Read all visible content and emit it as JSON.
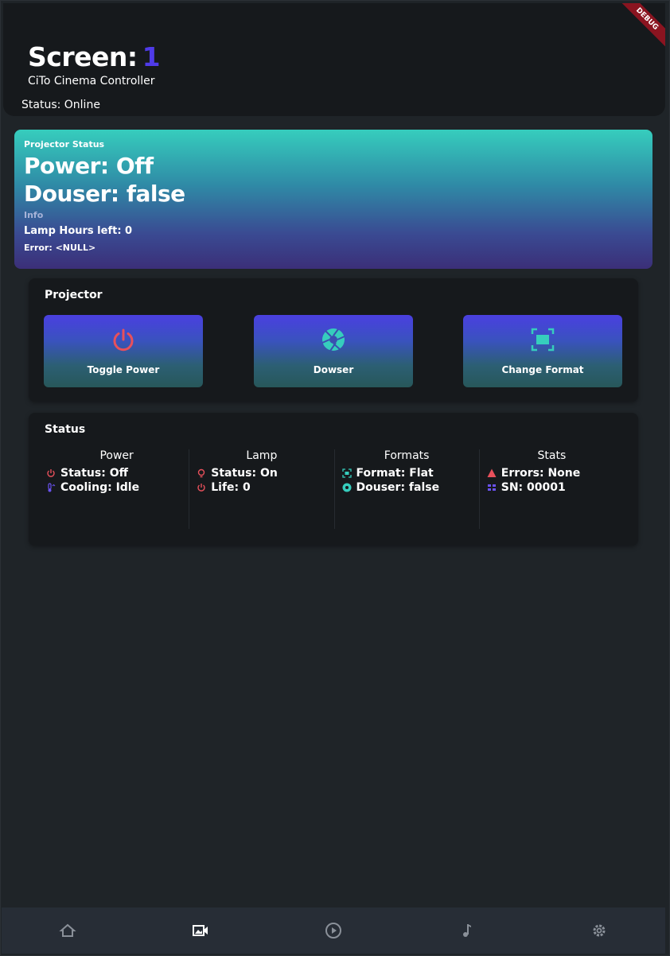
{
  "header": {
    "title": "Screen:",
    "screen_number": "1",
    "subtitle": "CiTo Cinema Controller",
    "status": "Status: Online",
    "debug_banner": "DEBUG"
  },
  "projector_status": {
    "label": "Projector Status",
    "power": "Power: Off",
    "douser": "Douser: false",
    "info_label": "Info",
    "lamp_hours": "Lamp Hours left: 0",
    "error": "Error: <NULL>"
  },
  "projector_card": {
    "title": "Projector",
    "buttons": [
      {
        "label": "Toggle Power",
        "icon": "power-icon"
      },
      {
        "label": "Dowser",
        "icon": "aperture-icon"
      },
      {
        "label": "Change Format",
        "icon": "fullscreen-icon"
      }
    ]
  },
  "status_card": {
    "title": "Status",
    "columns": [
      {
        "heading": "Power",
        "rows": [
          {
            "text": "Status: Off",
            "icon": "power-icon"
          },
          {
            "text": "Cooling: Idle",
            "icon": "thermometer-icon"
          }
        ]
      },
      {
        "heading": "Lamp",
        "rows": [
          {
            "text": "Status: On",
            "icon": "lightbulb-icon"
          },
          {
            "text": "Life: 0",
            "icon": "power-icon"
          }
        ]
      },
      {
        "heading": "Formats",
        "rows": [
          {
            "text": "Format: Flat",
            "icon": "fullscreen-icon"
          },
          {
            "text": "Douser: false",
            "icon": "aperture-icon"
          }
        ]
      },
      {
        "heading": "Stats",
        "rows": [
          {
            "text": "Errors: None",
            "icon": "warning-icon"
          },
          {
            "text": "SN: 00001",
            "icon": "serial-icon"
          }
        ]
      }
    ]
  },
  "bottom_nav": {
    "items": [
      {
        "icon": "home-icon",
        "active": false
      },
      {
        "icon": "video-icon",
        "active": true
      },
      {
        "icon": "play-icon",
        "active": false
      },
      {
        "icon": "music-icon",
        "active": false
      },
      {
        "icon": "settings-icon",
        "active": false
      }
    ]
  },
  "colors": {
    "accent": "#4f3be8",
    "teal": "#36cdbd",
    "red_icon": "#e8505b",
    "background": "#1f2428",
    "card": "#16191c"
  }
}
